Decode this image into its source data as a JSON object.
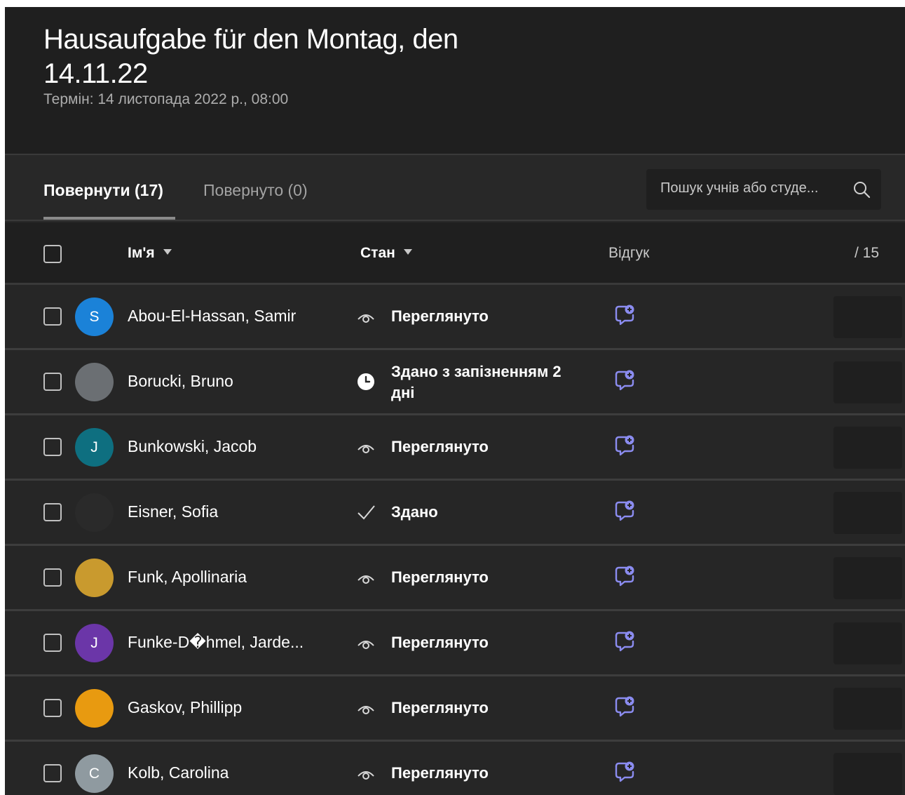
{
  "assignment": {
    "title": "Hausaufgabe für den Montag, den 14.11.22",
    "due": "Термін: 14 листопада 2022 р., 08:00"
  },
  "tabs": [
    {
      "label": "Повернути (17)",
      "active": true
    },
    {
      "label": "Повернуто (0)",
      "active": false
    }
  ],
  "search": {
    "placeholder": "Пошук учнів або студе..."
  },
  "columns": {
    "name": "Ім'я",
    "status": "Стан",
    "feedback": "Відгук",
    "points": "/ 15"
  },
  "colors": {
    "background": "#282828",
    "header": "#1f1f1f",
    "accent_feedback": "#8b8cf0"
  },
  "students": [
    {
      "name": "Abou-El-Hassan, Samir",
      "initial": "S",
      "avatar_color": "#1b82d8",
      "status": "Переглянуто",
      "status_icon": "eye-icon"
    },
    {
      "name": "Borucki, Bruno",
      "initial": "",
      "avatar_color": "#6b6f73",
      "status": "Здано з запізненням 2 дні",
      "status_icon": "clock-icon"
    },
    {
      "name": "Bunkowski, Jacob",
      "initial": "J",
      "avatar_color": "#0e6f80",
      "status": "Переглянуто",
      "status_icon": "eye-icon"
    },
    {
      "name": "Eisner, Sofia",
      "initial": "",
      "avatar_color": "#2a2a2a",
      "status": "Здано",
      "status_icon": "checkmark-icon"
    },
    {
      "name": "Funk, Apollinaria",
      "initial": "",
      "avatar_color": "#c99a2e",
      "status": "Переглянуто",
      "status_icon": "eye-icon"
    },
    {
      "name": "Funke-D�hmel, Jarde...",
      "initial": "J",
      "avatar_color": "#6b36a8",
      "status": "Переглянуто",
      "status_icon": "eye-icon"
    },
    {
      "name": "Gaskov, Phillipp",
      "initial": "",
      "avatar_color": "#e89a10",
      "status": "Переглянуто",
      "status_icon": "eye-icon"
    },
    {
      "name": "Kolb, Carolina",
      "initial": "C",
      "avatar_color": "#8f9aa0",
      "status": "Переглянуто",
      "status_icon": "eye-icon"
    }
  ]
}
